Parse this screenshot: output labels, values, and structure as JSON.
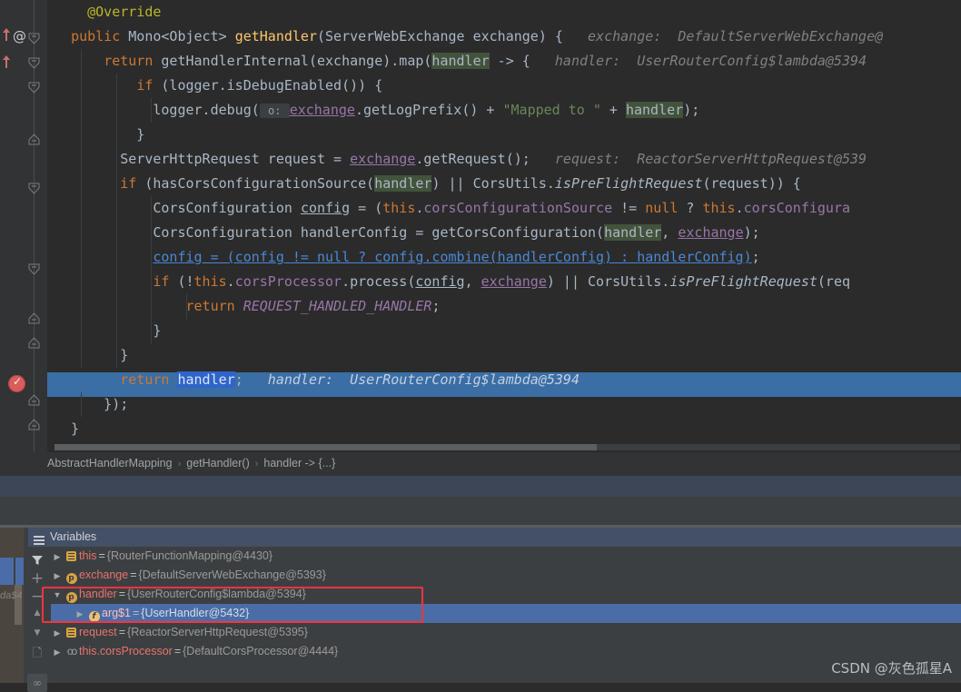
{
  "editor": {
    "lines": [
      {
        "indentGuides": [],
        "tokens": [
          {
            "t": "    ",
            "c": "id"
          },
          {
            "t": "@Override",
            "c": "ann"
          }
        ]
      },
      {
        "indentGuides": [],
        "tokens": [
          {
            "t": "  ",
            "c": "id"
          },
          {
            "t": "public ",
            "c": "kw"
          },
          {
            "t": "Mono<Object> ",
            "c": "id"
          },
          {
            "t": "getHandler",
            "c": "mth"
          },
          {
            "t": "(ServerWebExchange exchange) {",
            "c": "id"
          },
          {
            "t": "   exchange:  DefaultServerWebExchange@",
            "c": "hint"
          }
        ]
      },
      {
        "indentGuides": [
          89
        ],
        "tokens": [
          {
            "t": "      ",
            "c": "id"
          },
          {
            "t": "return ",
            "c": "kw"
          },
          {
            "t": "getHandlerInternal(exchange).map(",
            "c": "id"
          },
          {
            "t": "handler",
            "c": "hl"
          },
          {
            "t": " -> {",
            "c": "id"
          },
          {
            "t": "   handler:  UserRouterConfig$lambda@5394",
            "c": "hint"
          }
        ]
      },
      {
        "indentGuides": [
          89,
          128
        ],
        "tokens": [
          {
            "t": "          ",
            "c": "id"
          },
          {
            "t": "if ",
            "c": "kw"
          },
          {
            "t": "(logger.isDebugEnabled()) {",
            "c": "id"
          }
        ]
      },
      {
        "indentGuides": [
          89,
          128,
          166
        ],
        "tokens": [
          {
            "t": "            ",
            "c": "id"
          },
          {
            "t": "logger.debug(",
            "c": "id"
          },
          {
            "t": " o: ",
            "c": "param"
          },
          {
            "t": "exchange",
            "c": "fld ul"
          },
          {
            "t": ".getLogPrefix() + ",
            "c": "id"
          },
          {
            "t": "\"Mapped to \"",
            "c": "str"
          },
          {
            "t": " + ",
            "c": "id"
          },
          {
            "t": "handler",
            "c": "hl"
          },
          {
            "t": ");",
            "c": "id"
          }
        ]
      },
      {
        "indentGuides": [
          89,
          128
        ],
        "tokens": [
          {
            "t": "          }",
            "c": "id"
          }
        ]
      },
      {
        "indentGuides": [
          89,
          128
        ],
        "tokens": [
          {
            "t": "        ",
            "c": "id"
          },
          {
            "t": "ServerHttpRequest request = ",
            "c": "id"
          },
          {
            "t": "exchange",
            "c": "fld ul"
          },
          {
            "t": ".getRequest();",
            "c": "id"
          },
          {
            "t": "   request:  ReactorServerHttpRequest@539",
            "c": "hint"
          }
        ]
      },
      {
        "indentGuides": [
          89,
          128
        ],
        "tokens": [
          {
            "t": "        ",
            "c": "id"
          },
          {
            "t": "if ",
            "c": "kw"
          },
          {
            "t": "(hasCorsConfigurationSource(",
            "c": "id"
          },
          {
            "t": "handler",
            "c": "hl"
          },
          {
            "t": ") || CorsUtils.",
            "c": "id"
          },
          {
            "t": "isPreFlightRequest",
            "c": "statm"
          },
          {
            "t": "(request)) {",
            "c": "id"
          }
        ]
      },
      {
        "indentGuides": [
          89,
          128,
          166
        ],
        "tokens": [
          {
            "t": "            ",
            "c": "id"
          },
          {
            "t": "CorsConfiguration ",
            "c": "id"
          },
          {
            "t": "config",
            "c": "id ul"
          },
          {
            "t": " = (",
            "c": "id"
          },
          {
            "t": "this",
            "c": "kw"
          },
          {
            "t": ".",
            "c": "id"
          },
          {
            "t": "corsConfigurationSource",
            "c": "fld"
          },
          {
            "t": " != ",
            "c": "id"
          },
          {
            "t": "null",
            "c": "kw"
          },
          {
            "t": " ? ",
            "c": "id"
          },
          {
            "t": "this",
            "c": "kw"
          },
          {
            "t": ".",
            "c": "id"
          },
          {
            "t": "corsConfigura",
            "c": "fld"
          }
        ]
      },
      {
        "indentGuides": [
          89,
          128,
          166
        ],
        "tokens": [
          {
            "t": "            ",
            "c": "id"
          },
          {
            "t": "CorsConfiguration handlerConfig = getCorsConfiguration(",
            "c": "id"
          },
          {
            "t": "handler",
            "c": "hl"
          },
          {
            "t": ", ",
            "c": "id"
          },
          {
            "t": "exchange",
            "c": "fld ul"
          },
          {
            "t": ");",
            "c": "id"
          }
        ]
      },
      {
        "indentGuides": [
          89,
          128,
          166
        ],
        "tokens": [
          {
            "t": "            ",
            "c": "id"
          },
          {
            "t": "config = (config != null ? config.combine(handlerConfig) : handlerConfig)",
            "c": "link"
          },
          {
            "t": ";",
            "c": "id"
          }
        ]
      },
      {
        "indentGuides": [
          89,
          128,
          166
        ],
        "tokens": [
          {
            "t": "            ",
            "c": "id"
          },
          {
            "t": "if ",
            "c": "kw"
          },
          {
            "t": "(!",
            "c": "id"
          },
          {
            "t": "this",
            "c": "kw"
          },
          {
            "t": ".",
            "c": "id"
          },
          {
            "t": "corsProcessor",
            "c": "fld"
          },
          {
            "t": ".process(",
            "c": "id"
          },
          {
            "t": "config",
            "c": "id ul"
          },
          {
            "t": ", ",
            "c": "id"
          },
          {
            "t": "exchange",
            "c": "fld ul"
          },
          {
            "t": ") || CorsUtils.",
            "c": "id"
          },
          {
            "t": "isPreFlightRequest",
            "c": "statm"
          },
          {
            "t": "(req",
            "c": "id"
          }
        ]
      },
      {
        "indentGuides": [
          89,
          128,
          166,
          205
        ],
        "tokens": [
          {
            "t": "                ",
            "c": "id"
          },
          {
            "t": "return ",
            "c": "kw"
          },
          {
            "t": "REQUEST_HANDLED_HANDLER",
            "c": "stat"
          },
          {
            "t": ";",
            "c": "id"
          }
        ]
      },
      {
        "indentGuides": [
          89,
          128,
          166
        ],
        "tokens": [
          {
            "t": "            }",
            "c": "id"
          }
        ]
      },
      {
        "indentGuides": [
          89,
          128
        ],
        "tokens": [
          {
            "t": "        }",
            "c": "id"
          }
        ]
      },
      {
        "indentGuides": [],
        "selected": true,
        "tokens": [
          {
            "t": "        ",
            "c": "id"
          },
          {
            "t": "return ",
            "c": "kw"
          },
          {
            "t": "handler",
            "c": "selword"
          },
          {
            "t": ";",
            "c": "id"
          },
          {
            "t": "   handler:  UserRouterConfig$lambda@5394",
            "c": "hint-sel"
          }
        ]
      },
      {
        "indentGuides": [
          89
        ],
        "tokens": [
          {
            "t": "      });",
            "c": "id"
          }
        ]
      },
      {
        "indentGuides": [],
        "tokens": [
          {
            "t": "  }",
            "c": "id"
          }
        ]
      }
    ],
    "gutter": {
      "override_markers": [
        "override-up-arrow",
        "override-up-arrow"
      ],
      "annotation_icon": "@",
      "breakpoint_icon": "breakpoint-verified"
    },
    "scrollbar": {
      "name": "horizontal-scrollbar"
    }
  },
  "breadcrumb": {
    "items": [
      "AbstractHandlerMapping",
      "getHandler()",
      "handler -> {...}"
    ],
    "separator": "›"
  },
  "debug": {
    "variables_tab": {
      "label": "Variables",
      "icon": "variables-icon"
    },
    "toolbar": [
      {
        "name": "filter-icon",
        "glyph": "⯈"
      },
      {
        "name": "add-watch-button",
        "glyph": "+"
      },
      {
        "name": "remove-watch-button",
        "glyph": "−"
      },
      {
        "name": "move-up-button",
        "glyph": "▲"
      },
      {
        "name": "move-down-button",
        "glyph": "▼"
      },
      {
        "name": "copy-button",
        "glyph": "❐"
      },
      {
        "name": "watches-toggle",
        "glyph": "oo"
      }
    ],
    "rows": [
      {
        "indent": 1,
        "expander": "▶",
        "expanded": false,
        "icon": "object",
        "name": "this",
        "eq": "=",
        "value": "{RouterFunctionMapping@4430}",
        "selected": false
      },
      {
        "indent": 1,
        "expander": "▶",
        "expanded": false,
        "icon": "param",
        "name": "exchange",
        "eq": "=",
        "value": "{DefaultServerWebExchange@5393}",
        "selected": false
      },
      {
        "indent": 1,
        "expander": "▼",
        "expanded": true,
        "icon": "param",
        "name": "handler",
        "eq": "=",
        "value": "{UserRouterConfig$lambda@5394}",
        "selected": false
      },
      {
        "indent": 2,
        "expander": "▶",
        "expanded": false,
        "icon": "field",
        "name": "arg$1",
        "eq": "=",
        "value": "{UserHandler@5432}",
        "selected": true
      },
      {
        "indent": 1,
        "expander": "▶",
        "expanded": false,
        "icon": "object",
        "name": "request",
        "eq": "=",
        "value": "{ReactorServerHttpRequest@5395}",
        "selected": false
      },
      {
        "indent": 1,
        "expander": "▶",
        "expanded": false,
        "icon": "watch",
        "name": "this.corsProcessor",
        "eq": "=",
        "value": "{DefaultCorsProcessor@4444}",
        "selected": false
      }
    ],
    "edge_panel": {
      "partial_text": "da$4"
    }
  },
  "annotation": {
    "name": "red-highlight-box",
    "color": "#f5333f"
  },
  "watermark": {
    "text": "CSDN @灰色孤星A"
  },
  "colors": {
    "editor_bg": "#2b2b2b",
    "gutter_bg": "#313335",
    "panel_bg": "#3c3f41",
    "selection_blue": "#3a6ea5",
    "word_selection": "#2f65ca",
    "tab_header": "#435066",
    "occurrence_highlight": "#43523b",
    "keyword": "#cc7832",
    "string": "#6a8759",
    "field": "#9876aa",
    "method": "#ffc66d",
    "annotation": "#bbb529",
    "hint": "#808080",
    "link": "#4a88d6",
    "var_name": "#e8726d",
    "breakpoint": "#db5c5c"
  }
}
